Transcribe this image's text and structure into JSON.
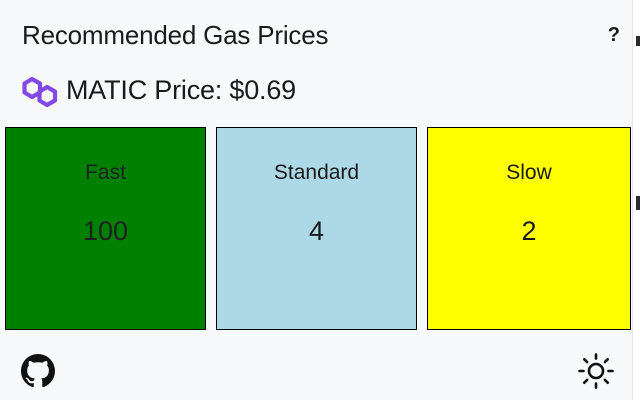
{
  "header": {
    "title": "Recommended Gas Prices",
    "help_label": "?"
  },
  "price": {
    "text": "MATIC Price: $0.69",
    "logo_color": "#8247e5"
  },
  "tiles": [
    {
      "label": "Fast",
      "value": "100",
      "color": "#008000"
    },
    {
      "label": "Standard",
      "value": "4",
      "color": "#add8e6"
    },
    {
      "label": "Slow",
      "value": "2",
      "color": "#ffff00"
    }
  ],
  "footer": {
    "github_icon": "github-icon",
    "theme_icon": "sun-icon"
  }
}
